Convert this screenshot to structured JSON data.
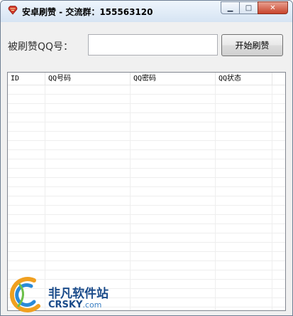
{
  "window": {
    "title": "安卓刷赞 - 交流群：155563120",
    "icon": "heart-shield-icon",
    "buttons": {
      "minimize": "▁",
      "maximize": "□",
      "close": "✕"
    }
  },
  "form": {
    "qq_label": "被刷赞QQ号：",
    "qq_value": "",
    "start_button": "开始刷赞"
  },
  "list": {
    "columns": [
      "ID",
      "QQ号码",
      "QQ密码",
      "QQ状态"
    ],
    "rows": []
  },
  "watermark": {
    "name_cn": "非凡软件站",
    "name_en": "CRSKY",
    "domain_suffix": ".com",
    "accent": "#1a4b8a"
  }
}
